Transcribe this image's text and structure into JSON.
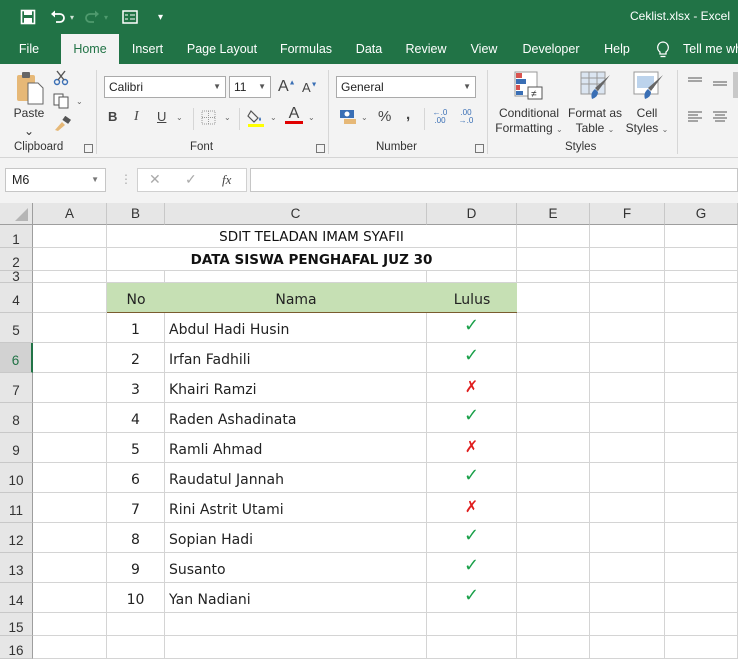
{
  "titlebar": {
    "window_title": "Ceklist.xlsx  -  Excel",
    "qat": {
      "save_icon": "save-icon",
      "undo_icon": "undo-icon",
      "redo_icon": "redo-icon",
      "form_icon": "form-icon",
      "customize_icon": "customize-qat-icon"
    }
  },
  "tabs": [
    {
      "label": "File"
    },
    {
      "label": "Home",
      "active": true
    },
    {
      "label": "Insert"
    },
    {
      "label": "Page Layout"
    },
    {
      "label": "Formulas"
    },
    {
      "label": "Data"
    },
    {
      "label": "Review"
    },
    {
      "label": "View"
    },
    {
      "label": "Developer"
    },
    {
      "label": "Help"
    },
    {
      "label": "Tell me wh"
    }
  ],
  "ribbon": {
    "clipboard": {
      "paste_label": "Paste",
      "group_label": "Clipboard"
    },
    "font": {
      "font_name": "Calibri",
      "font_size": "11",
      "bold": "B",
      "italic": "I",
      "underline": "U",
      "group_label": "Font",
      "grow": "A",
      "shrink": "A",
      "font_color_letter": "A"
    },
    "number": {
      "format": "General",
      "percent": "%",
      "comma": ",",
      "inc_decimal": "←.0 .00",
      "dec_decimal": ".00 →.0",
      "group_label": "Number"
    },
    "styles": {
      "conditional_line1": "Conditional",
      "conditional_line2": "Formatting",
      "table_line1": "Format as",
      "table_line2": "Table",
      "cellstyles_line1": "Cell",
      "cellstyles_line2": "Styles",
      "group_label": "Styles"
    },
    "colors": {
      "highlight": "#ffff00",
      "font_color": "#e00000",
      "accent": "#217346"
    }
  },
  "formula_bar": {
    "name_box": "M6",
    "cancel": "✕",
    "enter": "✓",
    "fx": "fx",
    "value": ""
  },
  "sheet": {
    "columns": [
      "A",
      "B",
      "C",
      "D",
      "E",
      "F",
      "G"
    ],
    "rows": [
      "1",
      "2",
      "3",
      "4",
      "5",
      "6",
      "7",
      "8",
      "9",
      "10",
      "11",
      "12",
      "13",
      "14",
      "15",
      "16"
    ],
    "selected_row": "6",
    "title1": "SDIT TELADAN IMAM SYAFII",
    "title2": "DATA SISWA PENGHAFAL JUZ 30",
    "header": {
      "no": "No",
      "nama": "Nama",
      "lulus": "Lulus"
    },
    "students": [
      {
        "no": "1",
        "nama": "Abdul Hadi Husin",
        "lulus": true
      },
      {
        "no": "2",
        "nama": "Irfan Fadhili",
        "lulus": true
      },
      {
        "no": "3",
        "nama": "Khairi Ramzi",
        "lulus": false
      },
      {
        "no": "4",
        "nama": "Raden Ashadinata",
        "lulus": true
      },
      {
        "no": "5",
        "nama": "Ramli Ahmad",
        "lulus": false
      },
      {
        "no": "6",
        "nama": "Raudatul Jannah",
        "lulus": true
      },
      {
        "no": "7",
        "nama": "Rini Astrit Utami",
        "lulus": false
      },
      {
        "no": "8",
        "nama": "Sopian Hadi",
        "lulus": true
      },
      {
        "no": "9",
        "nama": "Susanto",
        "lulus": true
      },
      {
        "no": "10",
        "nama": "Yan Nadiani",
        "lulus": true
      }
    ],
    "check_glyph": "✓",
    "cross_glyph": "✗",
    "header_fill": "#c6e0b4",
    "check_color": "#1aa04a",
    "cross_color": "#e01e1e"
  }
}
